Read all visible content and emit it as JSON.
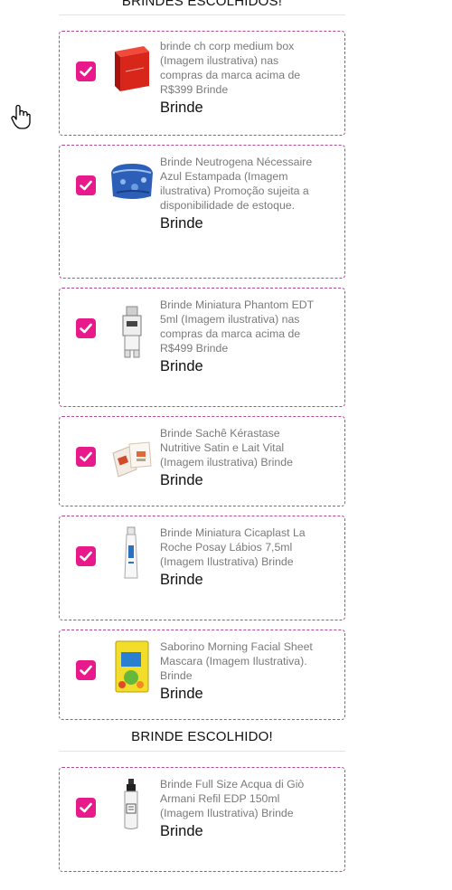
{
  "sections": {
    "multi_title": "BRINDES ESCOLHIDOS!",
    "single_title": "BRINDE ESCOLHIDO!"
  },
  "gifts": [
    {
      "description": "brinde ch corp medium box (Imagem ilustrativa) nas compras da marca acima de R$399 Brinde",
      "tag": "Brinde",
      "checked": true,
      "icon": "red-gift-box"
    },
    {
      "description": "Brinde Neutrogena Nécessaire Azul Estampada (Imagem ilustrativa) Promoção sujeita a disponibilidade de estoque.",
      "tag": "Brinde",
      "checked": true,
      "icon": "blue-pouch"
    },
    {
      "description": "Brinde Miniatura Phantom EDT 5ml (Imagem ilustrativa) nas compras da marca acima de R$499 Brinde",
      "tag": "Brinde",
      "checked": true,
      "icon": "robot-perfume-bottle"
    },
    {
      "description": "Brinde Sachê Kérastase Nutritive Satin e Lait Vital (Imagem ilustrativa) Brinde",
      "tag": "Brinde",
      "checked": true,
      "icon": "sachet-packets"
    },
    {
      "description": "Brinde Miniatura Cicaplast La Roche Posay Lábios 7,5ml (Imagem Ilustrativa) Brinde",
      "tag": "Brinde",
      "checked": true,
      "icon": "lip-balm-tube"
    },
    {
      "description": "Saborino Morning Facial Sheet Mascara (Imagem Ilustrativa). Brinde",
      "tag": "Brinde",
      "checked": true,
      "icon": "sheet-mask-pack"
    }
  ],
  "chosen_gift": {
    "description": "Brinde Full Size Acqua di Giò Armani Refil EDP 150ml (Imagem Ilustrativa) Brinde",
    "tag": "Brinde",
    "checked": true,
    "icon": "perfume-refill-bottle"
  },
  "colors": {
    "accent": "#e8198b",
    "card_border": "#b04a94"
  },
  "cursor_icon": "hand-pointer-icon"
}
